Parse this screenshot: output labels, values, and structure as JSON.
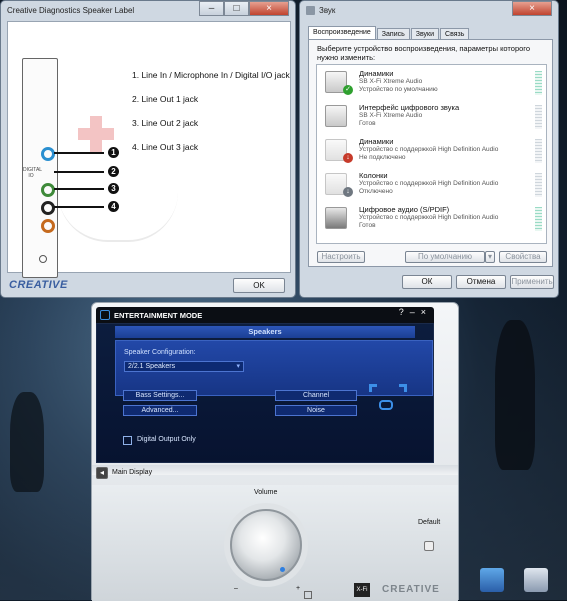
{
  "diagnostics": {
    "title": "Creative Diagnostics Speaker Label",
    "min": "–",
    "max": "□",
    "close": "×",
    "card_label": "DIGITAL IO",
    "jacks": [
      {
        "num": "1",
        "label": "1. Line In / Microphone In / Digital I/O jack",
        "color": "#2a8fd0"
      },
      {
        "num": "2",
        "label": "2. Line Out 1 jack",
        "color": "#3f8a3a"
      },
      {
        "num": "3",
        "label": "3. Line Out 2 jack",
        "color": "#222222"
      },
      {
        "num": "4",
        "label": "4. Line Out 3 jack",
        "color": "#c56a1e"
      }
    ],
    "logo": "CREATIVE",
    "ok_label": "OK"
  },
  "sound": {
    "title": "Звук",
    "close": "×",
    "tabs": [
      "Воспроизведение",
      "Запись",
      "Звуки",
      "Связь"
    ],
    "description": "Выберите устройство воспроизведения, параметры которого нужно изменить:",
    "devices": [
      {
        "name": "Динамики",
        "sub1": "SB X-Fi Xtreme Audio",
        "sub2": "Устройство по умолчанию",
        "status": "default"
      },
      {
        "name": "Интерфейс цифрового звука",
        "sub1": "SB X-Fi Xtreme Audio",
        "sub2": "Готов",
        "status": "ready"
      },
      {
        "name": "Динамики",
        "sub1": "Устройство с поддержкой High Definition Audio",
        "sub2": "Не подключено",
        "status": "unplugged"
      },
      {
        "name": "Колонки",
        "sub1": "Устройство с поддержкой High Definition Audio",
        "sub2": "Отключено",
        "status": "disabled"
      },
      {
        "name": "Цифровое аудио (S/PDIF)",
        "sub1": "Устройство с поддержкой High Definition Audio",
        "sub2": "Готов",
        "status": "ready"
      }
    ],
    "configure": "Настроить",
    "default": "По умолчанию",
    "properties": "Свойства",
    "ok": "ОК",
    "cancel": "Отмена",
    "apply": "Применить"
  },
  "entertainment": {
    "title": "ENTERTAINMENT MODE",
    "help": "?",
    "minimize": "–",
    "close": "×",
    "section": "Speakers",
    "config_label": "Speaker Configuration:",
    "config_value": "2/2.1 Speakers",
    "bass": "Bass Settings...",
    "advanced": "Advanced...",
    "channel": "Channel",
    "noise": "Noise",
    "digital_output": "Digital Output Only",
    "main_display": "Main Display",
    "volume": "Volume",
    "default_label": "Default",
    "minus": "–",
    "plus": "+",
    "xfi": "X-Fi",
    "brand": "CREATIVE"
  }
}
